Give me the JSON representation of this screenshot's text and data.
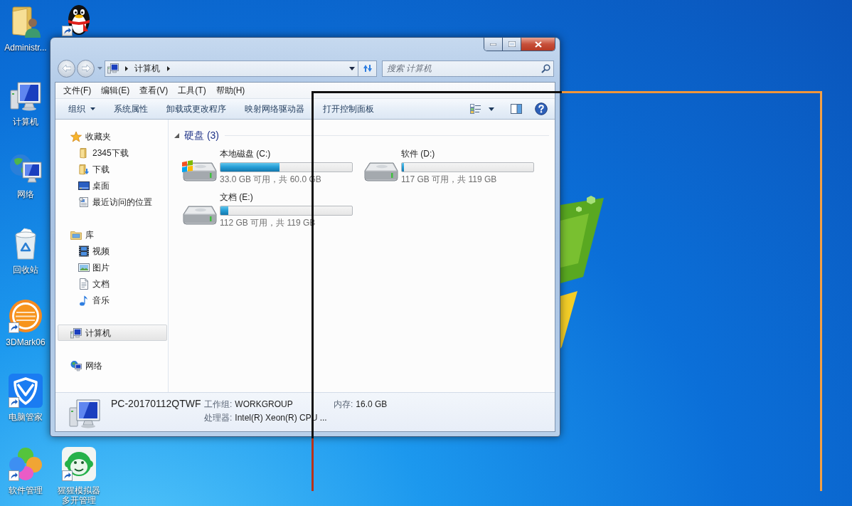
{
  "desktop_icons": [
    {
      "label": "Administr...",
      "shortcut": false
    },
    {
      "shortcut": true
    },
    {
      "label": "计算机",
      "shortcut": false
    },
    {
      "label": "网络",
      "shortcut": false
    },
    {
      "label": "回收站",
      "shortcut": false
    },
    {
      "label": "3DMark06",
      "shortcut": true
    },
    {
      "label": "电脑管家",
      "shortcut": true
    },
    {
      "label": "软件管理",
      "shortcut": true
    },
    {
      "label": "猩猩模拟器多开管理",
      "shortcut": true
    }
  ],
  "window": {
    "back": {
      "disabled": true
    },
    "forward": {
      "disabled": true
    },
    "address": {
      "crumbs": [
        "计算机"
      ]
    },
    "search": {
      "placeholder": "搜索 计算机"
    },
    "menu": [
      "文件(F)",
      "编辑(E)",
      "查看(V)",
      "工具(T)",
      "帮助(H)"
    ],
    "commands": [
      {
        "label": "组织",
        "dropdown": true
      },
      {
        "label": "系统属性",
        "dropdown": false
      },
      {
        "label": "卸载或更改程序",
        "dropdown": false
      },
      {
        "label": "映射网络驱动器",
        "dropdown": false
      },
      {
        "label": "打开控制面板",
        "dropdown": false
      }
    ],
    "sidebar": [
      {
        "label": "收藏夹",
        "selected": false,
        "children": [
          {
            "label": "2345下载",
            "selected": false
          },
          {
            "label": "下载",
            "selected": false
          },
          {
            "label": "桌面",
            "selected": false
          },
          {
            "label": "最近访问的位置",
            "selected": false
          }
        ]
      },
      {
        "label": "库",
        "selected": false,
        "children": [
          {
            "label": "视频",
            "selected": false
          },
          {
            "label": "图片",
            "selected": false
          },
          {
            "label": "文档",
            "selected": false
          },
          {
            "label": "音乐",
            "selected": false
          }
        ]
      },
      {
        "label": "计算机",
        "selected": true
      },
      {
        "label": "网络",
        "selected": false
      }
    ],
    "section": {
      "title": "硬盘 (3)",
      "expanded": true,
      "drives": [
        {
          "name": "本地磁盘 (C:)",
          "system": true,
          "level": 0.45,
          "space": "33.0 GB 可用，共 60.0 GB"
        },
        {
          "name": "软件 (D:)",
          "system": false,
          "level": 0.017,
          "space": "117 GB 可用，共 119 GB"
        },
        {
          "name": "文档 (E:)",
          "system": false,
          "level": 0.06,
          "space": "112 GB 可用，共 119 GB"
        }
      ]
    },
    "details": {
      "name": "PC-20170112QTWF",
      "fields": [
        {
          "label": "工作组:",
          "value": "WORKGROUP"
        },
        {
          "label": "内存:",
          "value": "16.0 GB"
        },
        {
          "label": "处理器:",
          "value": "Intel(R) Xeon(R) CPU ..."
        }
      ]
    }
  }
}
